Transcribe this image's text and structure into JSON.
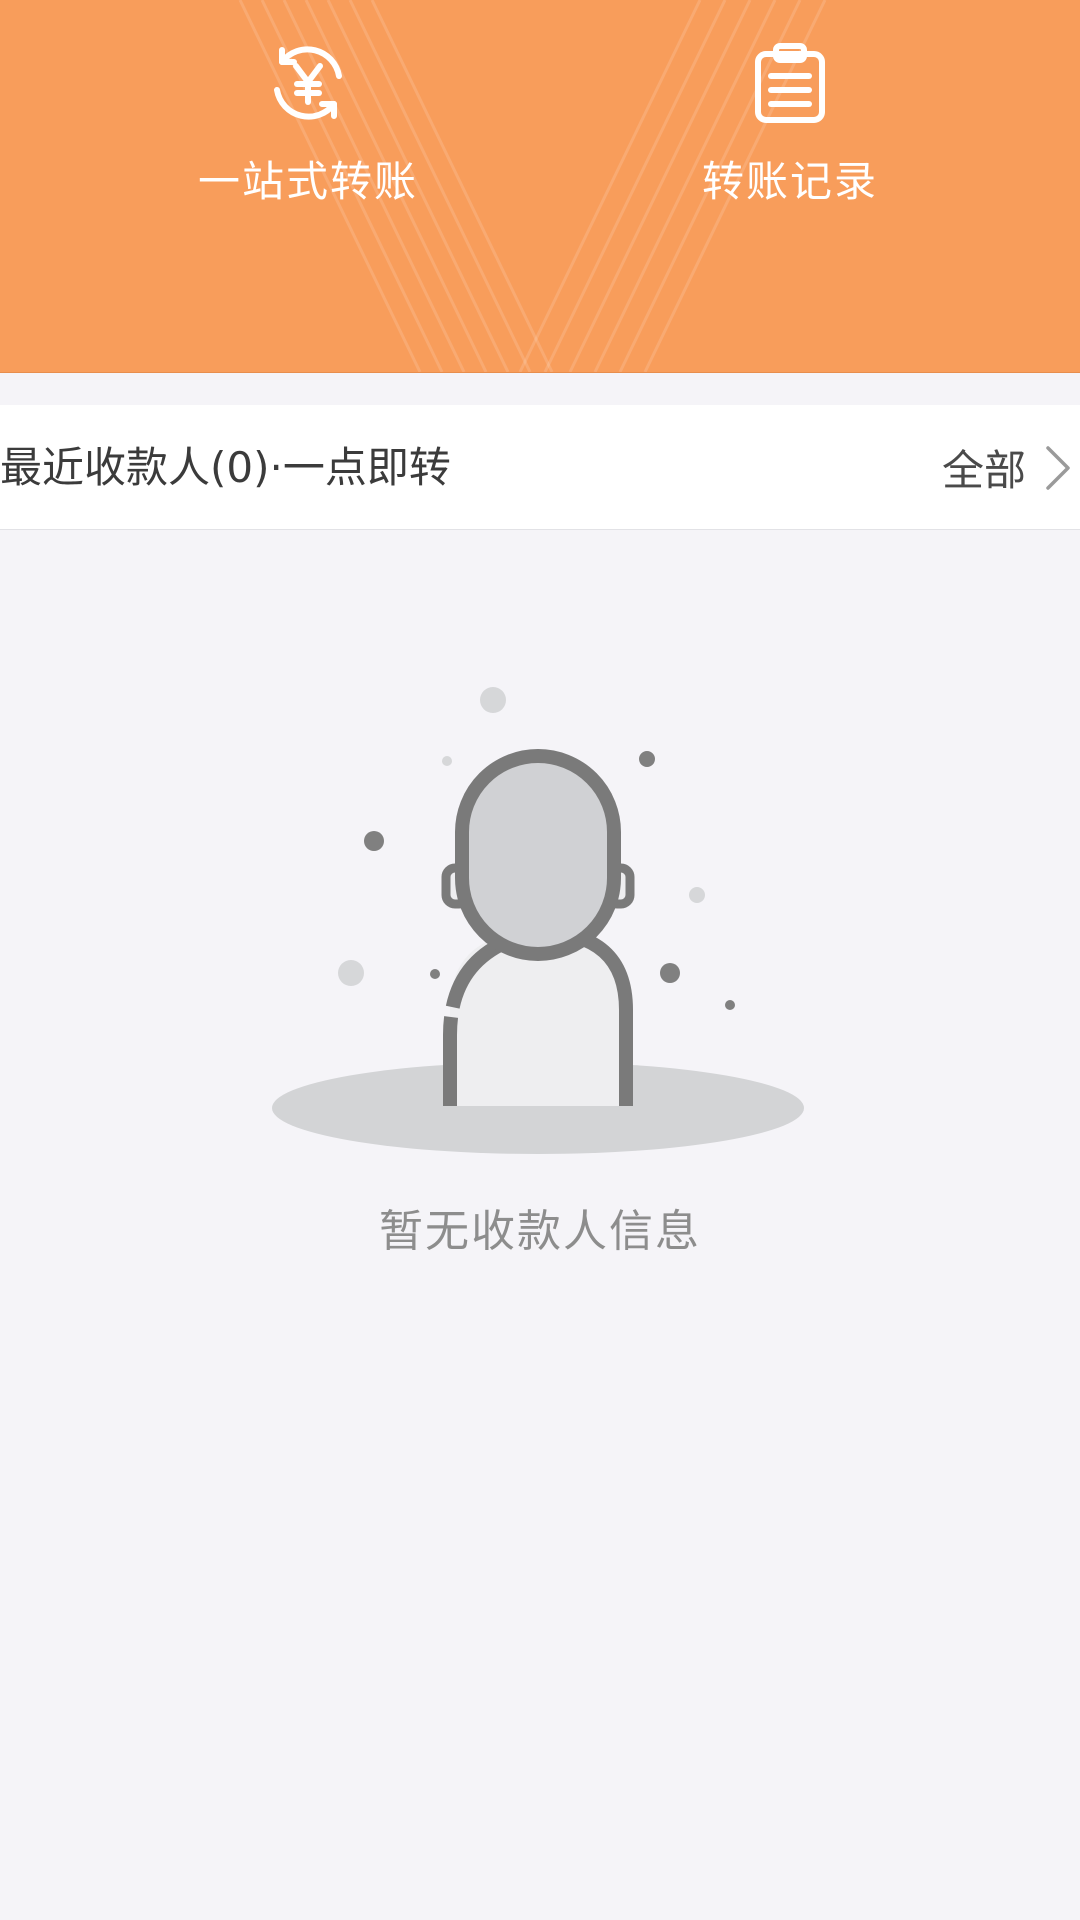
{
  "header": {
    "background": "#f89d5b",
    "actions": [
      {
        "label": "一站式转账",
        "icon": "yuan-transfer-icon"
      },
      {
        "label": "转账记录",
        "icon": "clipboard-list-icon"
      }
    ]
  },
  "recent": {
    "title": "最近收款人(0)·一点即转",
    "all_label": "全部",
    "all_icon": "chevron-right-icon"
  },
  "empty_state": {
    "illustration": "empty-person-icon",
    "message": "暂无收款人信息"
  }
}
